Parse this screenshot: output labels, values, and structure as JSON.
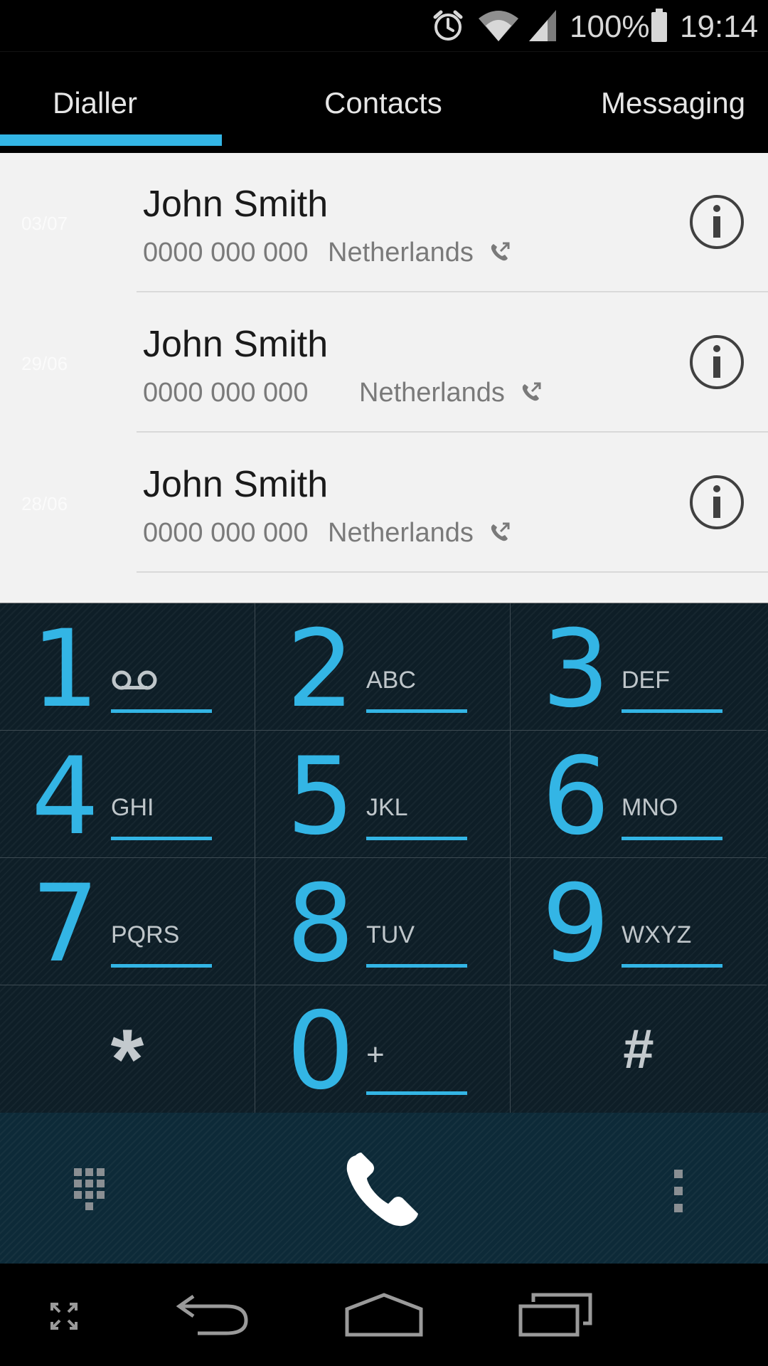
{
  "status_bar": {
    "battery": "100%",
    "time": "19:14",
    "icons": [
      "alarm-icon",
      "wifi-icon",
      "signal-icon",
      "battery-icon"
    ]
  },
  "tabs": [
    {
      "label": "Dialler",
      "selected": true
    },
    {
      "label": "Contacts",
      "selected": false
    },
    {
      "label": "Messaging",
      "selected": false
    }
  ],
  "call_log": [
    {
      "date": "03/07",
      "name": "John Smith",
      "number": "0000 000 000",
      "country": "Netherlands",
      "call_type_icon": "outgoing-call-icon"
    },
    {
      "date": "29/06",
      "name": "John Smith",
      "number": "0000 000 000",
      "country": "Netherlands",
      "call_type_icon": "outgoing-call-icon"
    },
    {
      "date": "28/06",
      "name": "John Smith",
      "number": "0000 000 000",
      "country": "Netherlands",
      "call_type_icon": "outgoing-call-icon"
    }
  ],
  "dialpad": {
    "keys": [
      {
        "digit": "1",
        "letters": "",
        "icon": "voicemail-icon"
      },
      {
        "digit": "2",
        "letters": "ABC"
      },
      {
        "digit": "3",
        "letters": "DEF"
      },
      {
        "digit": "4",
        "letters": "GHI"
      },
      {
        "digit": "5",
        "letters": "JKL"
      },
      {
        "digit": "6",
        "letters": "MNO"
      },
      {
        "digit": "7",
        "letters": "PQRS"
      },
      {
        "digit": "8",
        "letters": "TUV"
      },
      {
        "digit": "9",
        "letters": "WXYZ"
      },
      {
        "digit": "*",
        "letters": ""
      },
      {
        "digit": "0",
        "letters": "+"
      },
      {
        "digit": "#",
        "letters": ""
      }
    ]
  },
  "action_bar": {
    "icons": [
      "dialpad-toggle-icon",
      "call-icon",
      "overflow-menu-icon"
    ]
  },
  "nav_bar": {
    "icons": [
      "expand-icon",
      "back-icon",
      "home-icon",
      "recents-icon"
    ]
  },
  "colors": {
    "accent": "#33b5e5",
    "call_log_bg": "#f2f2f2",
    "dialpad_bg": "#0e1e27",
    "action_bar_bg": "#0d2a38"
  }
}
